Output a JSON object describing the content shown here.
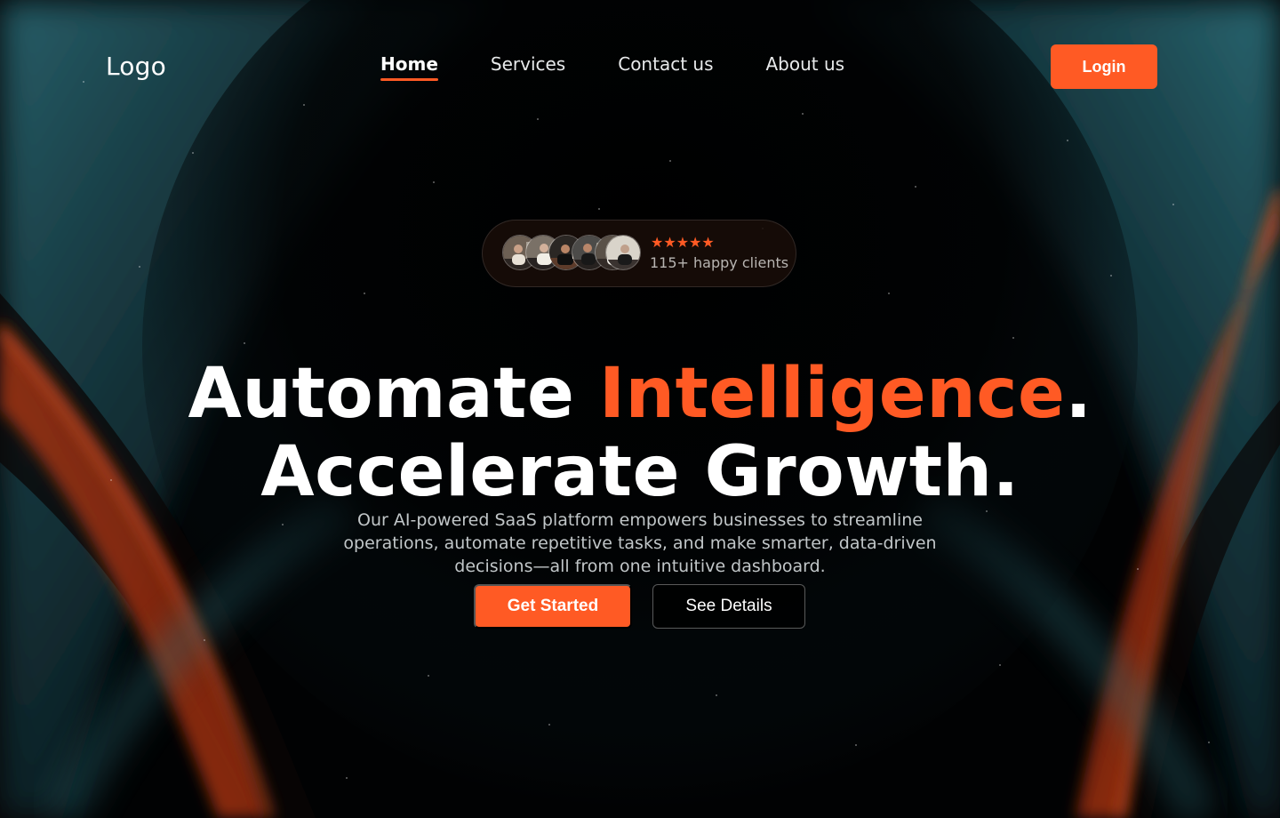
{
  "nav": {
    "logo": "Logo",
    "links": [
      {
        "label": "Home",
        "active": true
      },
      {
        "label": "Services",
        "active": false
      },
      {
        "label": "Contact us",
        "active": false
      },
      {
        "label": "About us",
        "active": false
      }
    ],
    "login_label": "Login"
  },
  "social_proof": {
    "stars": "★★★★★",
    "clients_text": "115+ happy clients",
    "avatar_count": 6
  },
  "hero": {
    "headline_part1": "Automate ",
    "headline_accent": "Intelligence",
    "headline_period": ".",
    "headline_line2": "Accelerate Growth.",
    "subtitle": "Our AI-powered SaaS platform empowers businesses to streamline operations, automate repetitive tasks, and make smarter, data-driven decisions—all from one intuitive dashboard.",
    "primary_cta": "Get Started",
    "secondary_cta": "See Details"
  },
  "colors": {
    "accent": "#ff5a24",
    "background": "#020507",
    "teal_glow": "#1f5c67"
  },
  "icons": {
    "star": "star-icon",
    "avatar": "avatar"
  }
}
